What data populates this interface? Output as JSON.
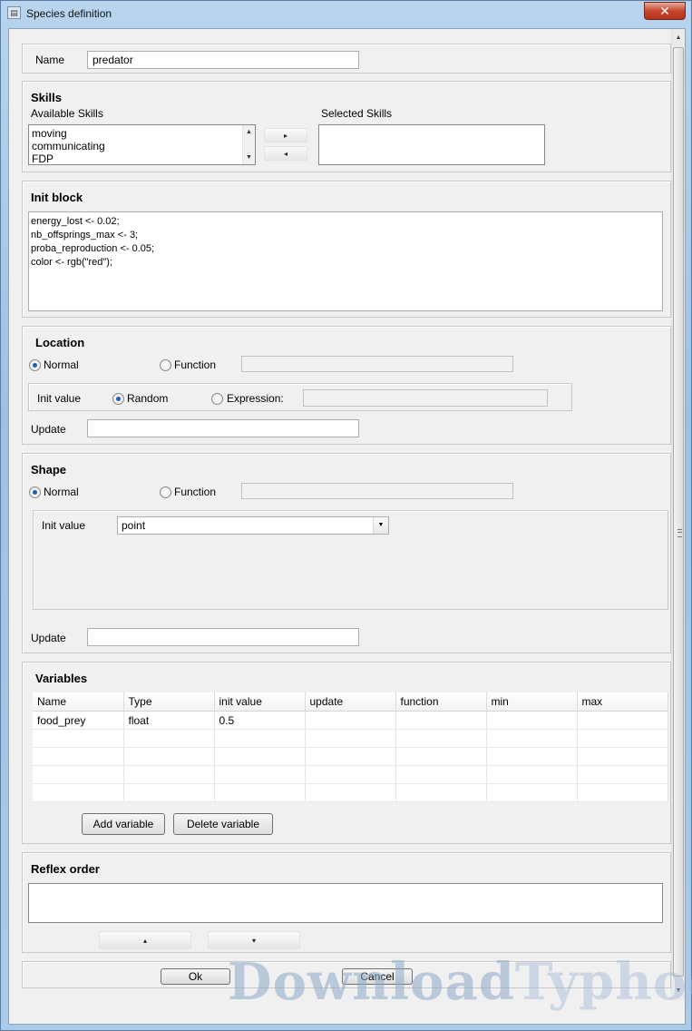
{
  "window": {
    "title": "Species definition",
    "close_glyph": "✕",
    "icon": "app-icon"
  },
  "name_section": {
    "label": "Name",
    "value": "predator"
  },
  "skills": {
    "title": "Skills",
    "available_label": "Available Skills",
    "selected_label": "Selected Skills",
    "available": [
      "moving",
      "communicating",
      "FDP"
    ],
    "selected": [],
    "add_glyph": "▸",
    "remove_glyph": "◂"
  },
  "init_block": {
    "title": "Init block",
    "lines": [
      "energy_lost <- 0.02;",
      "nb_offsprings_max <- 3;",
      "proba_reproduction <- 0.05;",
      "color <- rgb(\"red\");"
    ]
  },
  "location": {
    "title": "Location",
    "normal_label": "Normal",
    "function_label": "Function",
    "mode": "Normal",
    "init_label": "Init value",
    "random_label": "Random",
    "expression_label": "Expression:",
    "init_mode": "Random",
    "update_label": "Update",
    "update_value": ""
  },
  "shape": {
    "title": "Shape",
    "normal_label": "Normal",
    "function_label": "Function",
    "mode": "Normal",
    "init_label": "Init value",
    "init_value": "point",
    "update_label": "Update",
    "update_value": ""
  },
  "variables": {
    "title": "Variables",
    "columns": [
      "Name",
      "Type",
      "init value",
      "update",
      "function",
      "min",
      "max"
    ],
    "rows": [
      [
        "food_prey",
        "float",
        "0.5",
        "",
        "",
        "",
        ""
      ],
      [
        "",
        "",
        "",
        "",
        "",
        "",
        ""
      ],
      [
        "",
        "",
        "",
        "",
        "",
        "",
        ""
      ],
      [
        "",
        "",
        "",
        "",
        "",
        "",
        ""
      ],
      [
        "",
        "",
        "",
        "",
        "",
        "",
        ""
      ]
    ],
    "add_label": "Add variable",
    "delete_label": "Delete variable"
  },
  "reflex_order": {
    "title": "Reflex order",
    "up_glyph": "▴",
    "down_glyph": "▾"
  },
  "footer": {
    "ok_label": "Ok",
    "cancel_label": "Cancel"
  },
  "watermark": {
    "part1": "Download",
    "part2": "Typhoon"
  }
}
